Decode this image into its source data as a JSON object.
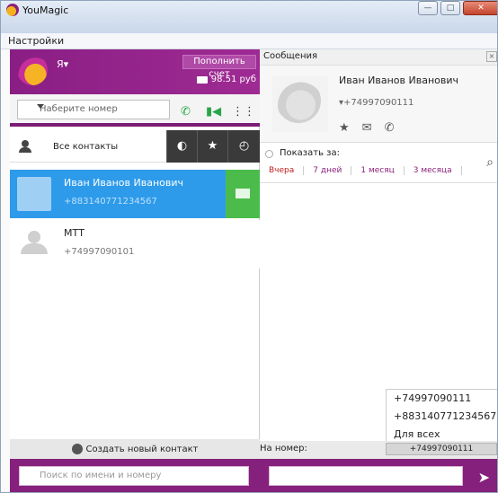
{
  "app": {
    "title": "YouMagic"
  },
  "menu": {
    "settings": "Настройки"
  },
  "account": {
    "name": "Я",
    "topup": "Пополнить счет",
    "balance": "98.51 руб"
  },
  "dialer": {
    "placeholder": "Наберите номер"
  },
  "tabs": {
    "all_contacts": "Все контакты"
  },
  "contacts": [
    {
      "name": "Иван Иванов Иванович",
      "number": "+883140771234567"
    },
    {
      "name": "МТТ",
      "number": "+74997090101"
    }
  ],
  "create_contact": "Создать новый контакт",
  "search": {
    "placeholder": "Поиск по имени и номеру"
  },
  "messages": {
    "title": "Сообщения"
  },
  "profile": {
    "name": "Иван Иванов Иванович",
    "number": "+74997090111"
  },
  "history": {
    "show_for": "Показать за:",
    "periods": [
      "Вчера",
      "7 дней",
      "1 месяц",
      "3 месяца"
    ]
  },
  "dropdown": {
    "items": [
      "+74997090111",
      "+883140771234567",
      "Для всех"
    ]
  },
  "to_row": {
    "label": "На номер:",
    "selected": "+74997090111"
  },
  "colors": {
    "accent": "#85207d",
    "selected_contact": "#2d9bea",
    "green": "#4bbc4b"
  }
}
